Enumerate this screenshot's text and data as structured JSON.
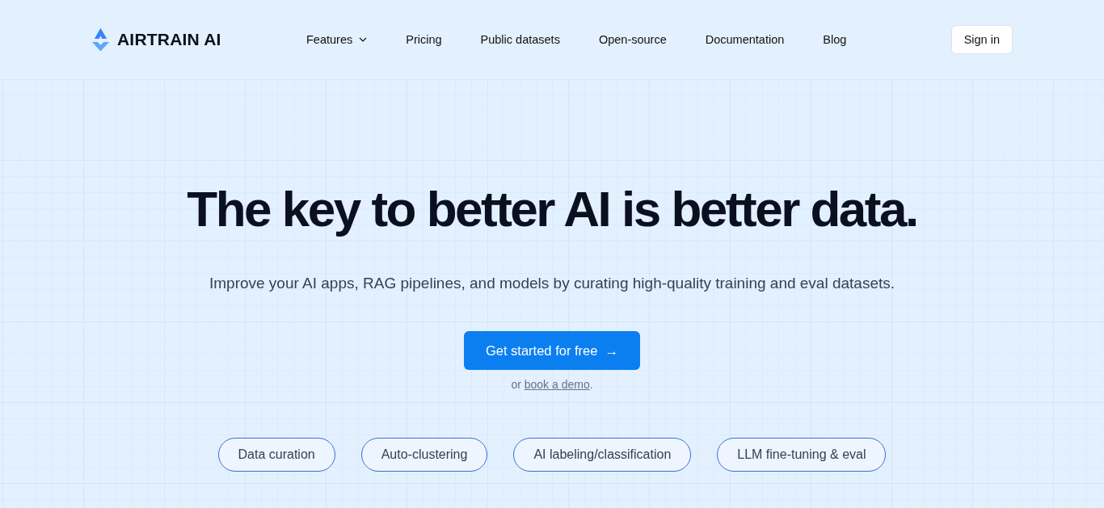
{
  "brand": {
    "name": "AIRTRAIN AI"
  },
  "nav": [
    {
      "label": "Features",
      "has_dropdown": true
    },
    {
      "label": "Pricing",
      "has_dropdown": false
    },
    {
      "label": "Public datasets",
      "has_dropdown": false
    },
    {
      "label": "Open-source",
      "has_dropdown": false
    },
    {
      "label": "Documentation",
      "has_dropdown": false
    },
    {
      "label": "Blog",
      "has_dropdown": false
    }
  ],
  "sign_in": "Sign in",
  "hero": {
    "title": "The key to better AI is better data.",
    "subtitle": "Improve your AI apps, RAG pipelines, and models by curating high-quality training and eval datasets.",
    "cta": {
      "label": "Get started for free",
      "arrow": "→"
    },
    "alt_prefix": "or",
    "alt_link": "book a demo",
    "alt_suffix": "."
  },
  "tags": [
    "Data curation",
    "Auto-clustering",
    "AI labeling/classification",
    "LLM fine-tuning & eval"
  ]
}
